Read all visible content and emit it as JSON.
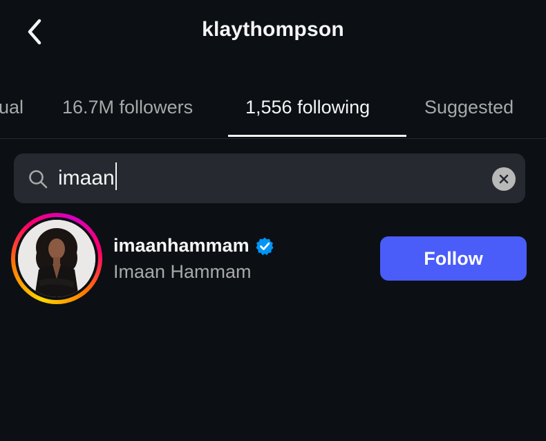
{
  "header": {
    "title": "klaythompson",
    "back_icon": "chevron-left-icon"
  },
  "tabs": [
    {
      "label": "ual"
    },
    {
      "label": "16.7M followers"
    },
    {
      "label": "1,556 following",
      "active": true
    },
    {
      "label": "Suggested"
    }
  ],
  "search": {
    "value": "imaan",
    "icon": "search-icon",
    "clear_icon": "close-circle-icon"
  },
  "result": {
    "username": "imaanhammam",
    "full_name": "Imaan Hammam",
    "verified": true,
    "follow_label": "Follow"
  },
  "colors": {
    "background": "#0c1014",
    "follow_button": "#4a5df9",
    "verified_badge": "#0095f6",
    "muted_text": "#a8a8a8"
  }
}
